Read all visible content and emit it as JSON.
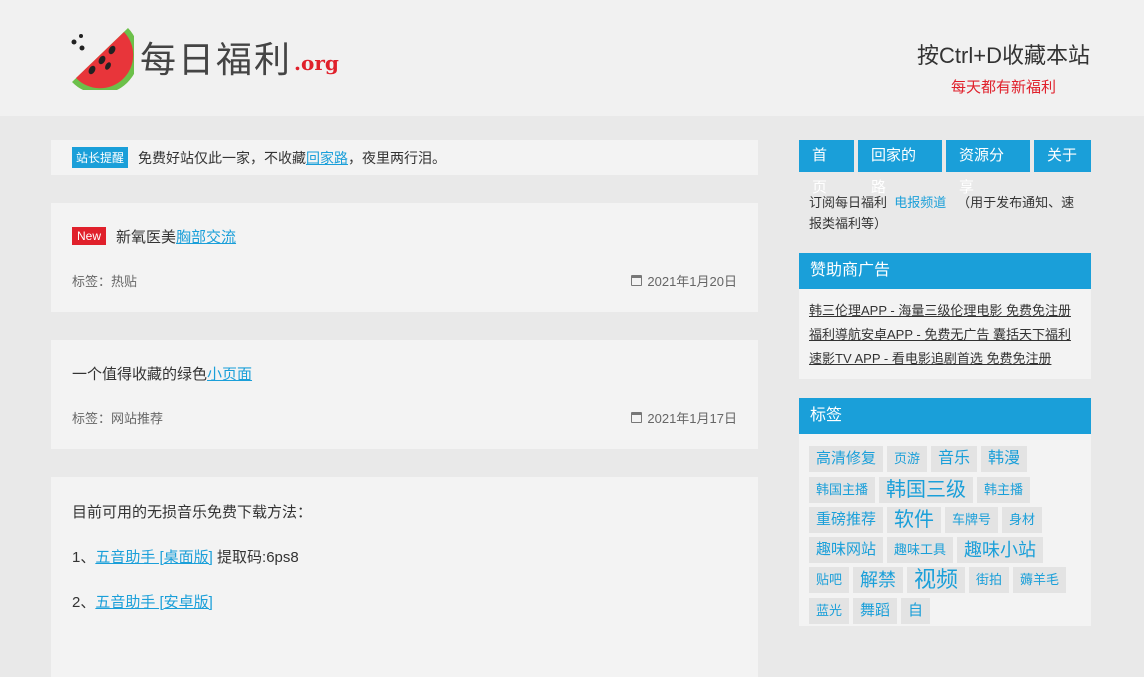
{
  "header": {
    "logo_text": "每日福利",
    "logo_domain": ".org",
    "bookmark_hint": "按Ctrl+D收藏本站",
    "tagline": "每天都有新福利"
  },
  "notice": {
    "badge": "站长提醒",
    "text_before": "免费好站仅此一家，不收藏",
    "link": "回家路",
    "text_after": "，夜里两行泪。"
  },
  "posts": [
    {
      "badge": "New",
      "title_text": "新氧医美",
      "title_link": "胸部交流",
      "tag_label": "标签：",
      "tag": "热贴",
      "date": "2021年1月20日"
    },
    {
      "title_text": "一个值得收藏的绿色",
      "title_link": "小页面",
      "tag_label": "标签：",
      "tag": "网站推荐",
      "date": "2021年1月17日"
    }
  ],
  "post3": {
    "intro": "目前可用的无损音乐免费下载方法：",
    "line1_prefix": "1、",
    "line1_link": "五音助手 [桌面版]",
    "line1_suffix": " 提取码:6ps8",
    "line2_prefix": "2、",
    "line2_link": "五音助手 [安卓版]"
  },
  "sidebar": {
    "nav": [
      "首页",
      "回家的路",
      "资源分享",
      "关于"
    ],
    "subscribe_text": "订阅每日福利",
    "subscribe_link": "电报频道",
    "subscribe_note": "（用于发布通知、速报类福利等）",
    "ads_title": "赞助商广告",
    "ads": [
      "韩三伦理APP - 海量三级伦理电影 免费免注册",
      "福利導航安卓APP - 免费无广告 囊括天下福利",
      "速影TV APP - 看电影追剧首选 免费免注册"
    ],
    "tags_title": "标签",
    "tags": [
      "高清修复",
      "页游",
      "音乐",
      "韩漫",
      "韩国主播",
      "韩国三级",
      "韩主播",
      "重磅推荐",
      "软件",
      "车牌号",
      "身材",
      "趣味网站",
      "趣味工具",
      "趣味小站",
      "贴吧",
      "解禁",
      "视频",
      "街拍",
      "薅羊毛",
      "蓝光",
      "舞蹈",
      "自"
    ]
  },
  "colors": {
    "accent": "#1a9fd9",
    "brand_red": "#e0202b"
  }
}
